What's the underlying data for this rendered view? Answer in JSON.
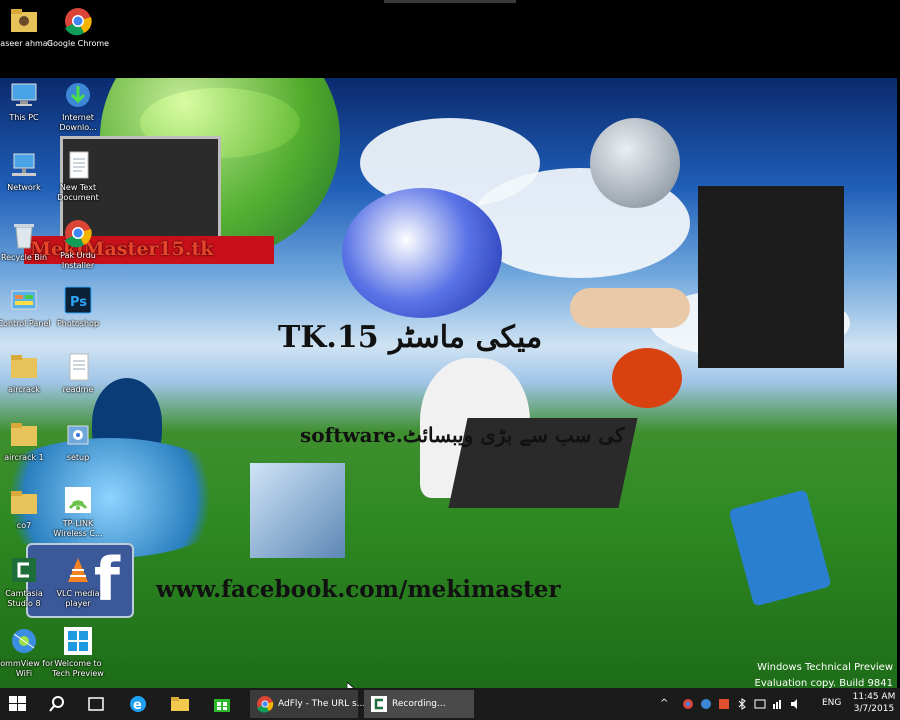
{
  "desktop_icons": [
    {
      "label": "naseer ahmad",
      "icon": "folder-user-icon"
    },
    {
      "label": "Google Chrome",
      "icon": "chrome-icon"
    },
    {
      "label": "This PC",
      "icon": "computer-icon"
    },
    {
      "label": "Internet Downlo...",
      "icon": "idm-icon"
    },
    {
      "label": "Network",
      "icon": "network-icon"
    },
    {
      "label": "New Text Document",
      "icon": "text-document-icon"
    },
    {
      "label": "Recycle Bin",
      "icon": "recycle-bin-icon"
    },
    {
      "label": "Pak Urdu Installer",
      "icon": "chrome-shortcut-icon"
    },
    {
      "label": "Control Panel",
      "icon": "control-panel-icon"
    },
    {
      "label": "Photoshop",
      "icon": "photoshop-icon"
    },
    {
      "label": "aircrack",
      "icon": "folder-icon"
    },
    {
      "label": "readme",
      "icon": "document-icon"
    },
    {
      "label": "aircrack 1",
      "icon": "folder-icon"
    },
    {
      "label": "setup",
      "icon": "setup-icon"
    },
    {
      "label": "co7",
      "icon": "folder-icon"
    },
    {
      "label": "TP-LINK Wireless C...",
      "icon": "wifi-icon"
    },
    {
      "label": "Camtasia Studio 8",
      "icon": "camtasia-icon"
    },
    {
      "label": "VLC media player",
      "icon": "vlc-icon"
    },
    {
      "label": "CommView for WiFi",
      "icon": "commview-icon"
    },
    {
      "label": "Welcome to Tech Preview",
      "icon": "windows-logo-icon"
    }
  ],
  "wallpaper": {
    "banner_text": "MekiMaster15.tk",
    "urdu_title_text": "TK.15 میکی ماسٹر",
    "urdu_subtitle_text": "software.کی سب سے بڑی ویبسائٹ",
    "facebook_url": "www.facebook.com/mekimaster"
  },
  "taskbar": {
    "apps": [
      {
        "label": "AdFly - The URL s...",
        "icon": "chrome-icon"
      },
      {
        "label": "Recording...",
        "icon": "camtasia-icon"
      }
    ],
    "tray": {
      "language": "ENG",
      "time": "11:45 AM",
      "date": "3/7/2015"
    }
  },
  "watermark": {
    "line1": "Windows Technical Preview",
    "line2": "Evaluation copy. Build 9841"
  },
  "colors": {
    "taskbar": "#1b1b1b",
    "active_app": "#3a3a3a",
    "banner_bg": "#c8101a",
    "banner_text": "#e9452a"
  }
}
